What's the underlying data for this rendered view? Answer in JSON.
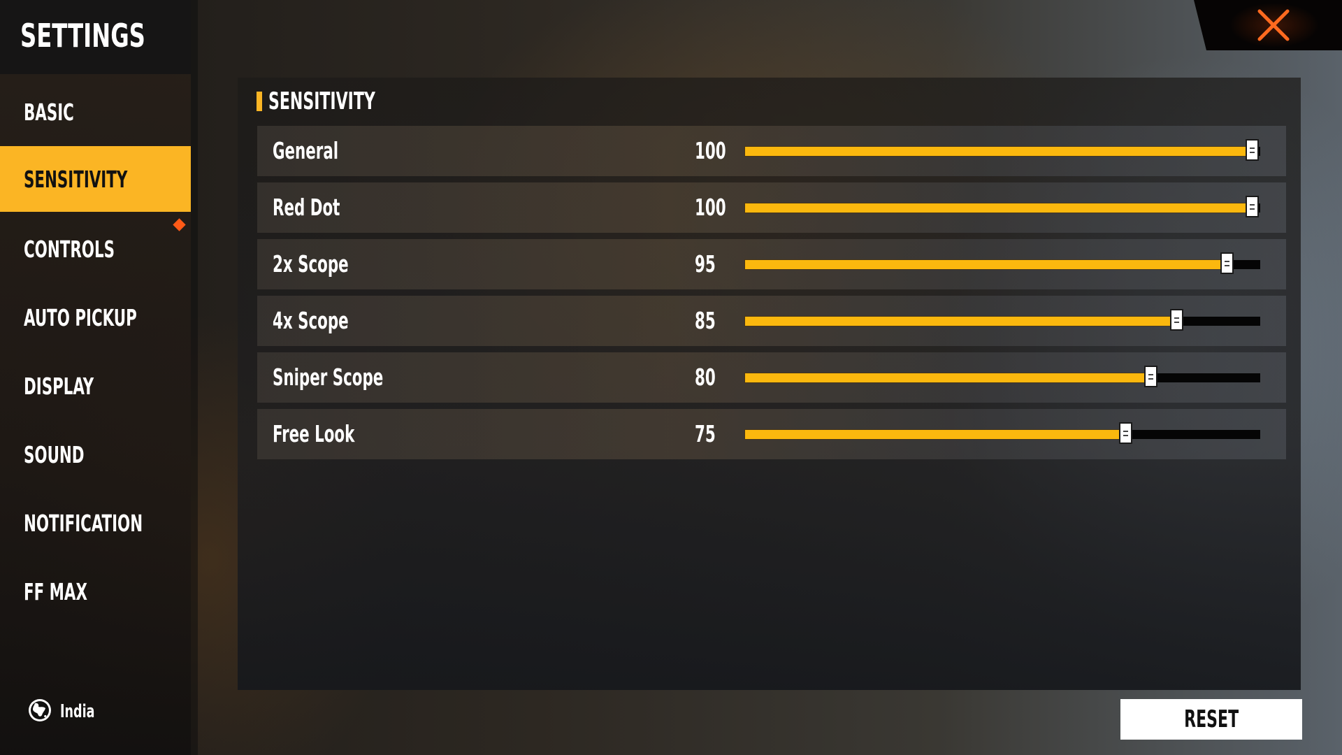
{
  "header": {
    "title": "SETTINGS"
  },
  "sidebar": {
    "items": [
      {
        "label": "BASIC",
        "active": false
      },
      {
        "label": "SENSITIVITY",
        "active": true
      },
      {
        "label": "CONTROLS",
        "active": false,
        "notification": true
      },
      {
        "label": "AUTO PICKUP",
        "active": false
      },
      {
        "label": "DISPLAY",
        "active": false
      },
      {
        "label": "SOUND",
        "active": false
      },
      {
        "label": "NOTIFICATION",
        "active": false
      },
      {
        "label": "FF MAX",
        "active": false
      }
    ],
    "region": {
      "label": "India",
      "icon": "globe-icon"
    }
  },
  "close": {
    "icon": "close-icon",
    "color": "#ff6a1f"
  },
  "section": {
    "title": "SENSITIVITY",
    "accent": "#fbb524"
  },
  "sliders": [
    {
      "label": "General",
      "value": "100",
      "level": 100
    },
    {
      "label": "Red Dot",
      "value": "100",
      "level": 100
    },
    {
      "label": "2x Scope",
      "value": "95",
      "level": 95
    },
    {
      "label": "4x Scope",
      "value": "85",
      "level": 85
    },
    {
      "label": "Sniper Scope",
      "value": "80",
      "level": 80
    },
    {
      "label": "Free Look",
      "value": "75",
      "level": 75
    }
  ],
  "slider_range": {
    "min": 0,
    "max": 100
  },
  "footer": {
    "reset_label": "RESET"
  }
}
